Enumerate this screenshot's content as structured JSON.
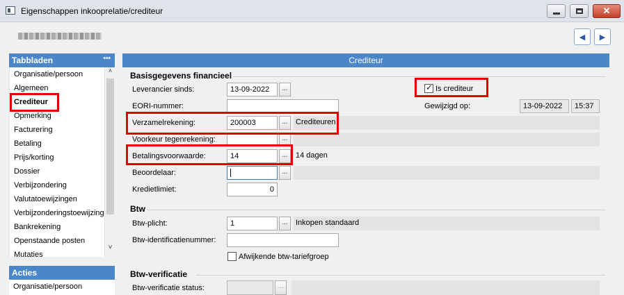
{
  "window": {
    "title": "Eigenschappen inkooprelatie/crediteur",
    "close_glyph": "✕"
  },
  "nav": {
    "prev_glyph": "◀",
    "next_glyph": "▶"
  },
  "sidebar": {
    "tabs_header": "Tabbladen",
    "tabs_menu": "•••",
    "tabs": [
      "Organisatie/persoon",
      "Algemeen",
      "Crediteur",
      "Opmerking",
      "Facturering",
      "Betaling",
      "Prijs/korting",
      "Dossier",
      "Verbijzondering",
      "Valutatoewijzingen",
      "Verbijzonderingstoewijzingen",
      "Bankrekening",
      "Openstaande posten",
      "Mutaties"
    ],
    "active_tab": "Crediteur",
    "scroll_up": "˄",
    "scroll_down": "˅",
    "acties_header": "Acties",
    "acties": [
      "Organisatie/persoon"
    ]
  },
  "main": {
    "header": "Crediteur",
    "financial": {
      "title": "Basisgegevens financieel",
      "leverancier_label": "Leverancier sinds:",
      "leverancier_value": "13-09-2022",
      "eori_label": "EORI-nummer:",
      "eori_value": "",
      "is_crediteur_label": "Is crediteur",
      "is_crediteur_checked": true,
      "gewijzigd_label": "Gewijzigd op:",
      "gewijzigd_date": "13-09-2022",
      "gewijzigd_time": "15:37",
      "verzamel_label": "Verzamelrekening:",
      "verzamel_value": "200003",
      "verzamel_desc": "Crediteuren",
      "voorkeur_label": "Voorkeur tegenrekening:",
      "voorkeur_value": "",
      "betalings_label": "Betalingsvoorwaarde:",
      "betalings_value": "14",
      "betalings_desc": "14 dagen",
      "beoordelaar_label": "Beoordelaar:",
      "beoordelaar_value": "",
      "kredietlimiet_label": "Kredietlimiet:",
      "kredietlimiet_value": "0"
    },
    "btw": {
      "title": "Btw",
      "plicht_label": "Btw-plicht:",
      "plicht_value": "1",
      "plicht_desc": "Inkopen standaard",
      "id_label": "Btw-identificatienummer:",
      "id_value": "",
      "afwijkend_label": "Afwijkende btw-tariefgroep",
      "afwijkend_checked": false
    },
    "verificatie": {
      "title": "Btw-verificatie",
      "status_label": "Btw-verificatie status:"
    },
    "lookup_glyph": "..."
  }
}
